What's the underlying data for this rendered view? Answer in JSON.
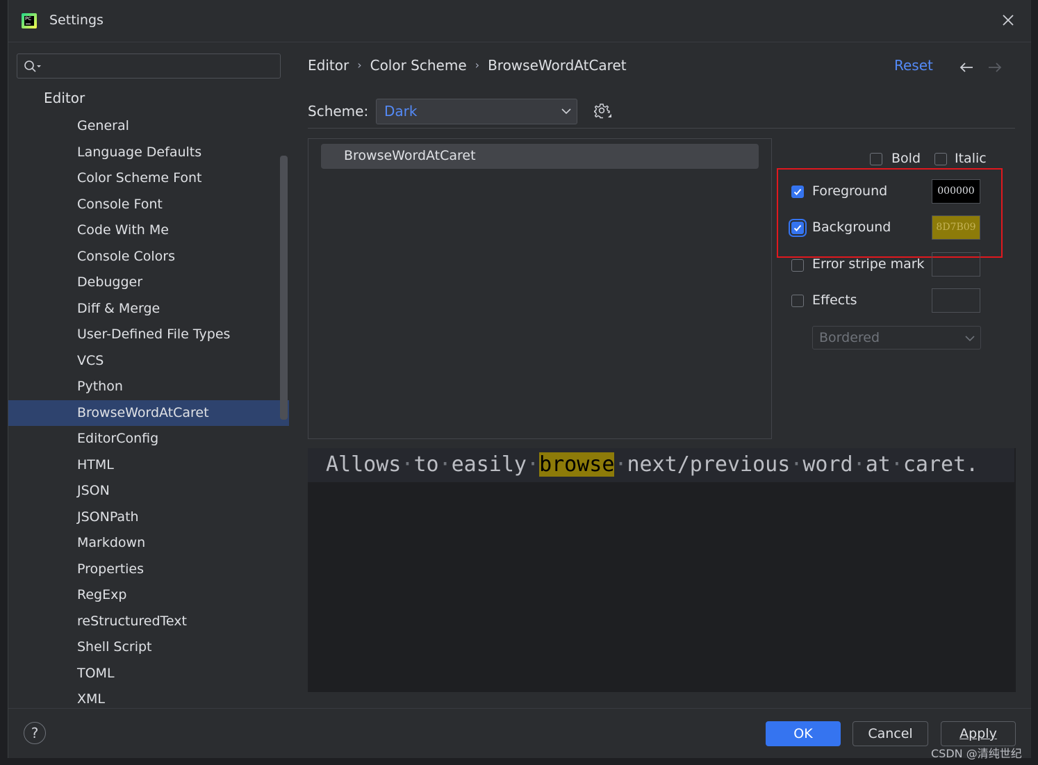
{
  "window": {
    "title": "Settings"
  },
  "sidebar": {
    "search_placeholder": "",
    "root": "Editor",
    "items": [
      {
        "label": "General"
      },
      {
        "label": "Language Defaults"
      },
      {
        "label": "Color Scheme Font"
      },
      {
        "label": "Console Font"
      },
      {
        "label": "Code With Me"
      },
      {
        "label": "Console Colors"
      },
      {
        "label": "Debugger"
      },
      {
        "label": "Diff & Merge"
      },
      {
        "label": "User-Defined File Types"
      },
      {
        "label": "VCS"
      },
      {
        "label": "Python"
      },
      {
        "label": "BrowseWordAtCaret",
        "selected": true
      },
      {
        "label": "EditorConfig"
      },
      {
        "label": "HTML"
      },
      {
        "label": "JSON"
      },
      {
        "label": "JSONPath"
      },
      {
        "label": "Markdown"
      },
      {
        "label": "Properties"
      },
      {
        "label": "RegExp"
      },
      {
        "label": "reStructuredText"
      },
      {
        "label": "Shell Script"
      },
      {
        "label": "TOML"
      },
      {
        "label": "XML"
      }
    ]
  },
  "breadcrumb": {
    "items": [
      "Editor",
      "Color Scheme",
      "BrowseWordAtCaret"
    ],
    "separator": "›"
  },
  "header": {
    "reset_label": "Reset",
    "back_icon": "arrow-left-icon",
    "forward_icon": "arrow-right-icon"
  },
  "scheme": {
    "label": "Scheme:",
    "value": "Dark"
  },
  "attributes": {
    "items": [
      "BrowseWordAtCaret"
    ]
  },
  "options": {
    "bold": {
      "label": "Bold",
      "checked": false
    },
    "italic": {
      "label": "Italic",
      "checked": false
    },
    "foreground": {
      "label": "Foreground",
      "checked": true,
      "color": "000000"
    },
    "background": {
      "label": "Background",
      "checked": true,
      "color": "8D7B09"
    },
    "error_stripe": {
      "label": "Error stripe mark",
      "checked": false
    },
    "effects": {
      "label": "Effects",
      "checked": false,
      "type": "Bordered"
    }
  },
  "preview": {
    "before": "Allows·to·easily·",
    "highlight": "browse",
    "after": "·next/previous·word·at·caret."
  },
  "buttons": {
    "ok": "OK",
    "cancel": "Cancel",
    "apply": "Apply",
    "help": "?"
  },
  "watermark": "CSDN @清纯世纪",
  "colors": {
    "accent": "#3574f0",
    "link": "#548af7",
    "highlight_box": "#e0181e",
    "background_swatch": "#8D7B09"
  }
}
